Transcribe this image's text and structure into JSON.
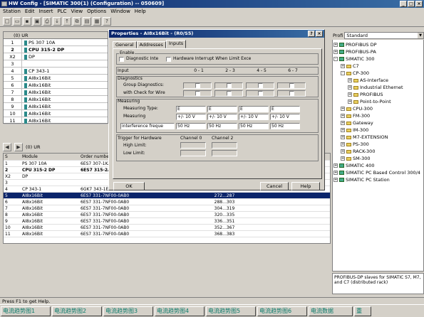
{
  "window": {
    "title": "HW Config - [SIMATIC 300(1) (Configuration) -- 050609]"
  },
  "menu": [
    "Station",
    "Edit",
    "Insert",
    "PLC",
    "View",
    "Options",
    "Window",
    "Help"
  ],
  "rack": {
    "header": "(0) UR",
    "rows": [
      {
        "slot": "1",
        "module": "PS 307 10A",
        "bold": false
      },
      {
        "slot": "2",
        "module": "CPU 315-2 DP",
        "bold": true
      },
      {
        "slot": "X2",
        "module": "DP",
        "bold": false
      },
      {
        "slot": "3",
        "module": "",
        "bold": false
      },
      {
        "slot": "4",
        "module": "CP 343-1",
        "bold": false
      },
      {
        "slot": "5",
        "module": "AI8x16Bit",
        "bold": false
      },
      {
        "slot": "6",
        "module": "AI8x16Bit",
        "bold": false
      },
      {
        "slot": "7",
        "module": "AI8x16Bit",
        "bold": false
      },
      {
        "slot": "8",
        "module": "AI8x16Bit",
        "bold": false
      },
      {
        "slot": "9",
        "module": "AI8x16Bit",
        "bold": false
      },
      {
        "slot": "10",
        "module": "AI8x16Bit",
        "bold": false
      },
      {
        "slot": "11",
        "module": "AI8x16Bit",
        "bold": false
      }
    ]
  },
  "lower": {
    "header": "(0)   UR",
    "columns": [
      "S",
      "Module",
      "Order number"
    ],
    "rows": [
      {
        "slot": "1",
        "module": "PS 307 10A",
        "order": "6ES7 307-1KA",
        "addr": "",
        "bold": false,
        "sel": false
      },
      {
        "slot": "2",
        "module": "CPU 315-2 DP",
        "order": "6ES7 315-2AG",
        "addr": "",
        "bold": true,
        "sel": false
      },
      {
        "slot": "X2",
        "module": "DP",
        "order": "",
        "addr": "",
        "bold": false,
        "sel": false
      },
      {
        "slot": "3",
        "module": "",
        "order": "",
        "addr": "",
        "bold": false,
        "sel": false
      },
      {
        "slot": "4",
        "module": "CP 343-1",
        "order": "6GK7 343-1E",
        "addr": "",
        "bold": false,
        "sel": false
      },
      {
        "slot": "5",
        "module": "AI8x16Bit",
        "order": "6ES7 331-7NF00-0AB0",
        "addr": "272...287",
        "bold": false,
        "sel": true
      },
      {
        "slot": "6",
        "module": "AI8x16Bit",
        "order": "6ES7 331-7NF00-0AB0",
        "addr": "288...303",
        "bold": false,
        "sel": false
      },
      {
        "slot": "7",
        "module": "AI8x16Bit",
        "order": "6ES7 331-7NF00-0AB0",
        "addr": "304...319",
        "bold": false,
        "sel": false
      },
      {
        "slot": "8",
        "module": "AI8x16Bit",
        "order": "6ES7 331-7NF00-0AB0",
        "addr": "320...335",
        "bold": false,
        "sel": false
      },
      {
        "slot": "9",
        "module": "AI8x16Bit",
        "order": "6ES7 331-7NF00-0AB0",
        "addr": "336...351",
        "bold": false,
        "sel": false
      },
      {
        "slot": "10",
        "module": "AI8x16Bit",
        "order": "6ES7 331-7NF00-0AB0",
        "addr": "352...367",
        "bold": false,
        "sel": false
      },
      {
        "slot": "11",
        "module": "AI8x16Bit",
        "order": "6ES7 331-7NF00-0AB0",
        "addr": "368...383",
        "bold": false,
        "sel": false
      }
    ]
  },
  "catalog": {
    "profile_label": "Profi",
    "profile_value": "Standard",
    "tree": [
      {
        "label": "PROFIBUS DP",
        "indent": 0,
        "exp": "+",
        "icon": "net"
      },
      {
        "label": "PROFIBUS-PA",
        "indent": 0,
        "exp": "+",
        "icon": "net"
      },
      {
        "label": "SIMATIC 300",
        "indent": 0,
        "exp": "-",
        "icon": "net"
      },
      {
        "label": "C7",
        "indent": 1,
        "exp": "+",
        "icon": "fold"
      },
      {
        "label": "CP-300",
        "indent": 1,
        "exp": "-",
        "icon": "fold"
      },
      {
        "label": "AS-Interface",
        "indent": 2,
        "exp": "+",
        "icon": "fold"
      },
      {
        "label": "Industrial Ethernet",
        "indent": 2,
        "exp": "+",
        "icon": "fold"
      },
      {
        "label": "PROFIBUS",
        "indent": 2,
        "exp": "+",
        "icon": "fold"
      },
      {
        "label": "Point-to-Point",
        "indent": 2,
        "exp": "+",
        "icon": "fold"
      },
      {
        "label": "CPU-300",
        "indent": 1,
        "exp": "+",
        "icon": "fold"
      },
      {
        "label": "FM-300",
        "indent": 1,
        "exp": "+",
        "icon": "fold"
      },
      {
        "label": "Gateway",
        "indent": 1,
        "exp": "+",
        "icon": "fold"
      },
      {
        "label": "IM-300",
        "indent": 1,
        "exp": "+",
        "icon": "fold"
      },
      {
        "label": "M7-EXTENSION",
        "indent": 1,
        "exp": "+",
        "icon": "fold"
      },
      {
        "label": "PS-300",
        "indent": 1,
        "exp": "+",
        "icon": "fold"
      },
      {
        "label": "RACK-300",
        "indent": 1,
        "exp": "+",
        "icon": "fold"
      },
      {
        "label": "SM-300",
        "indent": 1,
        "exp": "+",
        "icon": "fold"
      },
      {
        "label": "SIMATIC 400",
        "indent": 0,
        "exp": "+",
        "icon": "net"
      },
      {
        "label": "SIMATIC PC Based Control 300/4",
        "indent": 0,
        "exp": "+",
        "icon": "net"
      },
      {
        "label": "SIMATIC PC Station",
        "indent": 0,
        "exp": "+",
        "icon": "net"
      }
    ],
    "info": "PROFIBUS-DP slaves for SIMATIC S7, M7, and C7 (distributed rack)"
  },
  "dialog": {
    "title": "Properties - AI8x16Bit - (R0/S5)",
    "tabs": [
      "General",
      "Addresses",
      "Inputs"
    ],
    "enable_label": "Enable",
    "diag_interrupt": "Diagnostic Inte",
    "hw_interrupt": "Hardware Interrupt When Limit Exce",
    "input_label": "Input",
    "channels": [
      "0 - 1",
      "2 - 3",
      "4 - 5",
      "6 - 7"
    ],
    "diagnostics_label": "Diagnostics",
    "group_diag": "Group Diagnostics:",
    "check_wire": "with Check for Wire",
    "measuring_label": "Measuring",
    "measuring_type": "Measuring Type:",
    "measuring": "Measuring",
    "type_values": [
      "E",
      "E",
      "E",
      "E"
    ],
    "range_values": [
      "+/- 10 V",
      "+/- 10 V",
      "+/- 10 V",
      "+/- 10 V"
    ],
    "interference_label": "interference freque",
    "interference_values": [
      "50 Hz",
      "50 Hz",
      "50 Hz",
      "50 Hz"
    ],
    "trigger_label": "Trigger for Hardware",
    "trig_ch0": "Channel 0",
    "trig_ch2": "Channel 2",
    "high_limit": "High Limit:",
    "low_limit": "Low Limit:",
    "ok": "OK",
    "cancel": "Cancel",
    "help": "Help"
  },
  "status": "Press F1 to get Help.",
  "taskbar": [
    "电流趋势图1",
    "电流趋势图2",
    "电流趋势图3",
    "电流趋势图4",
    "电流趋势图5",
    "电流趋势图6",
    "电流数据",
    "重"
  ]
}
